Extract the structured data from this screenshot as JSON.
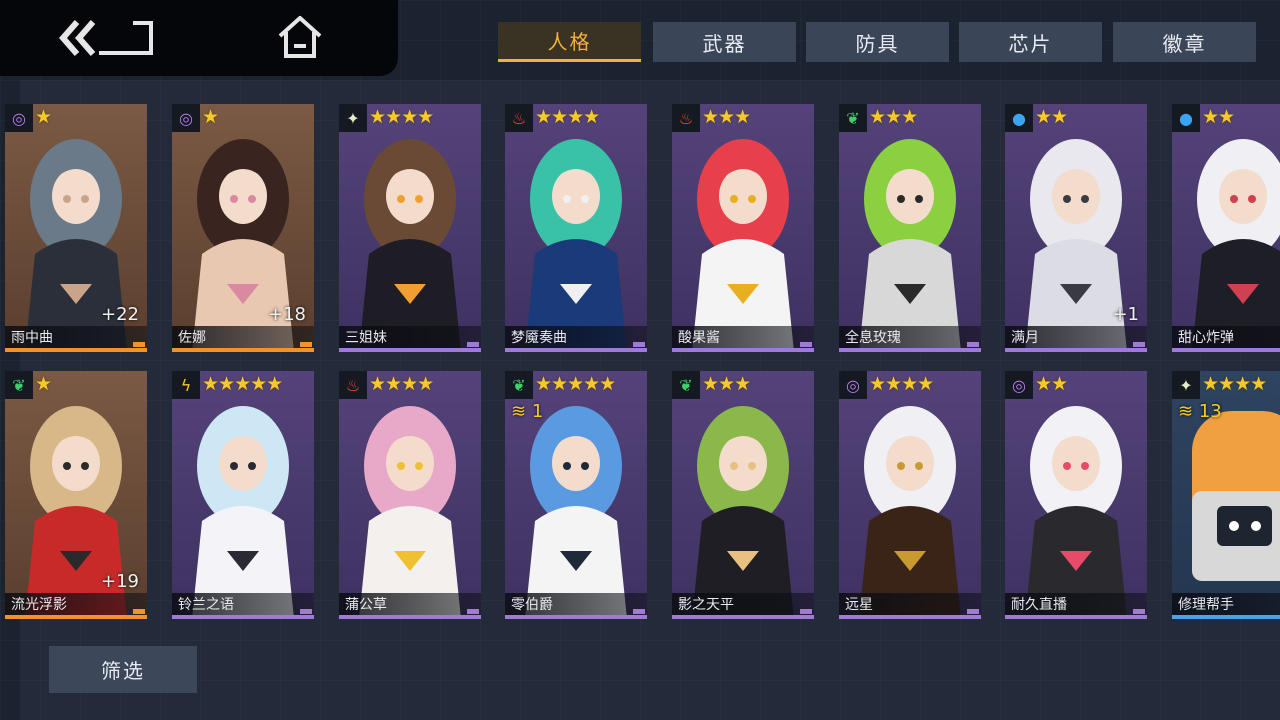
{
  "nav": {
    "back": "back",
    "home": "home"
  },
  "tabs": [
    {
      "label": "人格",
      "active": true
    },
    {
      "label": "武器",
      "active": false
    },
    {
      "label": "防具",
      "active": false
    },
    {
      "label": "芯片",
      "active": false
    },
    {
      "label": "徽章",
      "active": false
    }
  ],
  "filter_label": "筛选",
  "colors": {
    "accent": "#f2b13a",
    "purple_card": "#4c3c6e",
    "orange_card": "#6b4a36",
    "star": "#f5c92a",
    "rarity_purple": "#a07ad8",
    "rarity_orange": "#f0932a",
    "rarity_blue": "#4aa3e8"
  },
  "cards": [
    {
      "name": "雨中曲",
      "stars": "★",
      "element": "spiral-icon",
      "count": "+22",
      "badge": "",
      "rarity": "orange"
    },
    {
      "name": "佐娜",
      "stars": "★",
      "element": "spiral-icon",
      "count": "+18",
      "badge": "",
      "rarity": "orange"
    },
    {
      "name": "三姐妹",
      "stars": "★★★★",
      "element": "sparkle-icon",
      "count": "",
      "badge": "",
      "rarity": "purple"
    },
    {
      "name": "梦魇奏曲",
      "stars": "★★★★",
      "element": "flame-icon",
      "count": "",
      "badge": "",
      "rarity": "purple"
    },
    {
      "name": "酸果酱",
      "stars": "★★★",
      "element": "flame-icon",
      "count": "",
      "badge": "",
      "rarity": "purple"
    },
    {
      "name": "全息玫瑰",
      "stars": "★★★",
      "element": "leaf-icon",
      "count": "",
      "badge": "",
      "rarity": "purple"
    },
    {
      "name": "满月",
      "stars": "★★",
      "element": "water-drop-icon",
      "count": "+1",
      "badge": "",
      "rarity": "purple"
    },
    {
      "name": "甜心炸弹",
      "stars": "★★",
      "element": "water-drop-icon",
      "count": "",
      "badge": "",
      "rarity": "purple"
    },
    {
      "name": "流光浮影",
      "stars": "★",
      "element": "leaf-icon",
      "count": "+19",
      "badge": "",
      "rarity": "orange"
    },
    {
      "name": "铃兰之语",
      "stars": "★★★★★",
      "element": "lightning-icon",
      "count": "",
      "badge": "",
      "rarity": "purple"
    },
    {
      "name": "蒲公草",
      "stars": "★★★★",
      "element": "flame-icon",
      "count": "",
      "badge": "",
      "rarity": "purple"
    },
    {
      "name": "零伯爵",
      "stars": "★★★★★",
      "element": "leaf-icon",
      "count": "",
      "badge": "1",
      "rarity": "purple"
    },
    {
      "name": "影之天平",
      "stars": "★★★",
      "element": "leaf-icon",
      "count": "",
      "badge": "",
      "rarity": "purple"
    },
    {
      "name": "远星",
      "stars": "★★★★",
      "element": "spiral-icon",
      "count": "",
      "badge": "",
      "rarity": "purple"
    },
    {
      "name": "耐久直播",
      "stars": "★★",
      "element": "spiral-icon",
      "count": "",
      "badge": "",
      "rarity": "purple"
    },
    {
      "name": "修理帮手",
      "stars": "★★★★",
      "element": "sparkle-icon",
      "count": "",
      "badge": "13",
      "rarity": "blue"
    }
  ]
}
